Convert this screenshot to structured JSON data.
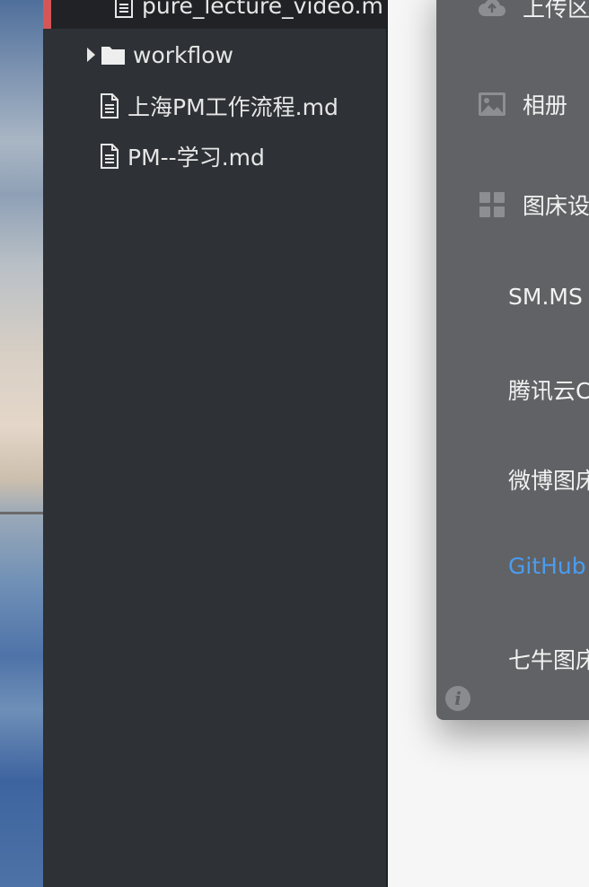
{
  "sidebar": {
    "items": [
      {
        "label": "pure_lecture_video.m",
        "type": "file",
        "active": true
      },
      {
        "label": "workflow",
        "type": "folder",
        "collapsed": true
      },
      {
        "label": "上海PM工作流程.md",
        "type": "file"
      },
      {
        "label": "PM--学习.md",
        "type": "file"
      }
    ]
  },
  "menu": {
    "items": [
      {
        "label": "上传区",
        "icon": "cloud-upload-icon"
      },
      {
        "label": "相册",
        "icon": "image-icon"
      },
      {
        "label": "图床设",
        "icon": "grid-icon"
      }
    ],
    "sub_items": [
      {
        "label": "SM.MS"
      },
      {
        "label": "腾讯云C"
      },
      {
        "label": "微博图床"
      },
      {
        "label": "GitHub",
        "active": true
      },
      {
        "label": "七牛图床"
      }
    ],
    "info_label": "i"
  },
  "colors": {
    "accent": "#4a9cf0",
    "active_marker": "#d65657",
    "menu_bg": "#616265",
    "sidebar_bg": "#2e3135"
  }
}
